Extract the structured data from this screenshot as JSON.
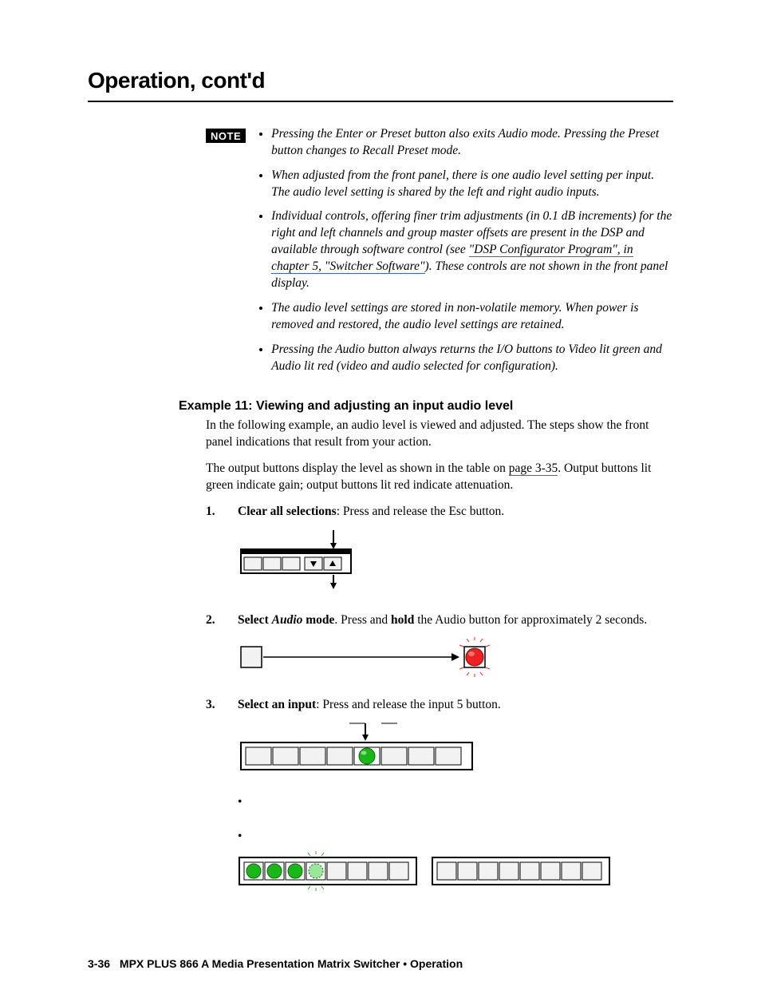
{
  "header": {
    "title": "Operation, cont'd"
  },
  "note": {
    "badge": "NOTE",
    "items": [
      "Pressing the Enter or Preset button also exits Audio mode.  Pressing the Preset button changes to Recall Preset mode.",
      "When adjusted from the front panel, there is one audio level setting per input.  The audio level setting is shared by the left and right audio inputs.",
      "Individual controls, offering finer trim adjustments (in 0.1 dB increments) for the right and left channels and group master offsets are present in the DSP and available through software control (see \"DSP Configurator Program\", in chapter 5, \"Switcher Software\").  These controls are not shown in the front panel display.",
      "The audio level settings are stored in non-volatile memory.  When power is removed and restored, the audio level settings are retained.",
      "Pressing the Audio button always returns the I/O buttons to Video lit green and Audio lit red (video and audio selected for configuration)."
    ],
    "link_text": "\"DSP Configurator Program\", in chapter 5, \"Switcher Software\""
  },
  "example": {
    "heading": "Example 11: Viewing and adjusting an input audio level",
    "intro": "In the following example, an audio level is viewed and adjusted.  The steps show the front panel indications that result from your action.",
    "ref_sentence_pre": "The output buttons display the level as shown in the table on ",
    "ref_link": "page 3-35",
    "ref_sentence_post": ".  Output buttons lit green indicate gain; output buttons lit red indicate attenuation.",
    "steps": [
      {
        "num": "1",
        "lead_bold": "Clear all selections",
        "rest": ": Press and release the Esc button."
      },
      {
        "num": "2",
        "lead_bold": "Select ",
        "italic": "Audio",
        "mid_bold": " mode",
        "rest": ".  Press and ",
        "hold": "hold",
        "rest2": " the Audio button for approximately 2 seconds."
      },
      {
        "num": "3",
        "lead_bold": "Select an input",
        "rest": ": Press and release the input 5 button."
      }
    ]
  },
  "footer": {
    "page": "3-36",
    "doc": "MPX PLUS 866 A Media Presentation Matrix Switcher • Operation"
  },
  "chart_data": {
    "type": "diagram",
    "figures": [
      {
        "step": 1,
        "description": "Front panel control strip with 4 blank cells plus down-arrow and up-arrow buttons; an arrow indicates pressing between the arrow buttons (Esc area)."
      },
      {
        "step": 2,
        "description": "Single unlit button on the left connected by a long horizontal arrow to a glowing red round button on the right (Audio button held)."
      },
      {
        "step": 3,
        "description": "Input button strip of 8 cells with the 5th cell showing a lit green round button and an arrow pointing down onto it."
      },
      {
        "step": "3b",
        "description": "Two button strips side by side. Left strip (inputs, 8 cells) has cells 1–3 lit solid green and cell 4 partially/blinking green. Right strip (outputs, 8 cells) all unlit."
      }
    ]
  }
}
